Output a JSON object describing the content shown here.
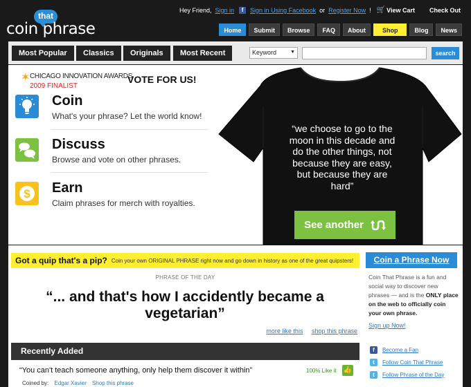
{
  "header": {
    "logo_small": "that",
    "logo_main": "coin phrase",
    "greeting": "Hey Friend,",
    "sign_in": "Sign in",
    "sign_in_facebook": "Sign in Using Facebook",
    "or": "or",
    "register": "Register Now",
    "bang": "!",
    "view_cart": "View Cart",
    "check_out": "Check Out"
  },
  "nav": {
    "items": [
      "Home",
      "Submit",
      "Browse",
      "FAQ",
      "About",
      "Shop",
      "Blog",
      "News"
    ],
    "active": "Home",
    "highlight": "Shop"
  },
  "categories": {
    "buttons": [
      "Most Popular",
      "Classics",
      "Originals",
      "Most Recent"
    ],
    "search_type": "Keyword",
    "search_placeholder": "",
    "search_button": "search"
  },
  "hero": {
    "award_line1": "CHICAGO INNOVATION AWARDS",
    "award_line2": "2009 FINALIST",
    "vote": "VOTE FOR US!",
    "features": [
      {
        "title": "Coin",
        "desc": "What's your phrase? Let the world know!",
        "icon": "lightbulb-icon",
        "color": "#2a8bd6"
      },
      {
        "title": "Discuss",
        "desc": "Browse and vote on other phrases.",
        "icon": "speech-bubbles-icon",
        "color": "#7cc240"
      },
      {
        "title": "Earn",
        "desc": "Claim phrases for merch with royalties.",
        "icon": "dollar-icon",
        "color": "#f6c21b"
      }
    ],
    "shirt_quote": "“we choose to go to the moon in this decade and do the other things, not because they are easy, but because they are hard”",
    "see_another": "See another"
  },
  "main": {
    "quip_bold": "Got a quip that's a pip?",
    "quip_rest": "Coin your own ORIGINAL PHRASE right now and go down in history as one of the great quipsters!",
    "potd_label": "PHRASE OF THE DAY",
    "potd_phrase": "“... and that's how I accidently became a vegetarian”",
    "more_like_this": "more like this",
    "shop_this_phrase": "shop this phrase",
    "recent_heading": "Recently Added",
    "recent_quote": "“You can't teach someone anything, only help them discover it within”",
    "recent_like": "100% Like it",
    "coined_by_label": "Coined by:",
    "coined_by_name": "Edgar Xavier",
    "recent_shop": "Shop this phrase"
  },
  "sidebar": {
    "coin_button": "Coin a Phrase Now",
    "about_pre": "Coin That Phrase is a fun and social way to discover new phrases — and is the",
    "about_only": "ONLY",
    "about_mid": "place on the web to officially",
    "about_end": "coin your own phrase.",
    "sign_up": "Sign up Now!",
    "social": [
      {
        "label": "Become a Fan",
        "icon": "facebook-icon"
      },
      {
        "label": "Follow Coin That Phrase",
        "icon": "twitter-icon"
      },
      {
        "label": "Follow Phrase of the Day",
        "icon": "twitter-icon"
      }
    ]
  },
  "colors": {
    "accent_blue": "#2a8bd6",
    "shop_yellow": "#ffef32",
    "green": "#7cc240",
    "award_red": "#d7261f"
  }
}
